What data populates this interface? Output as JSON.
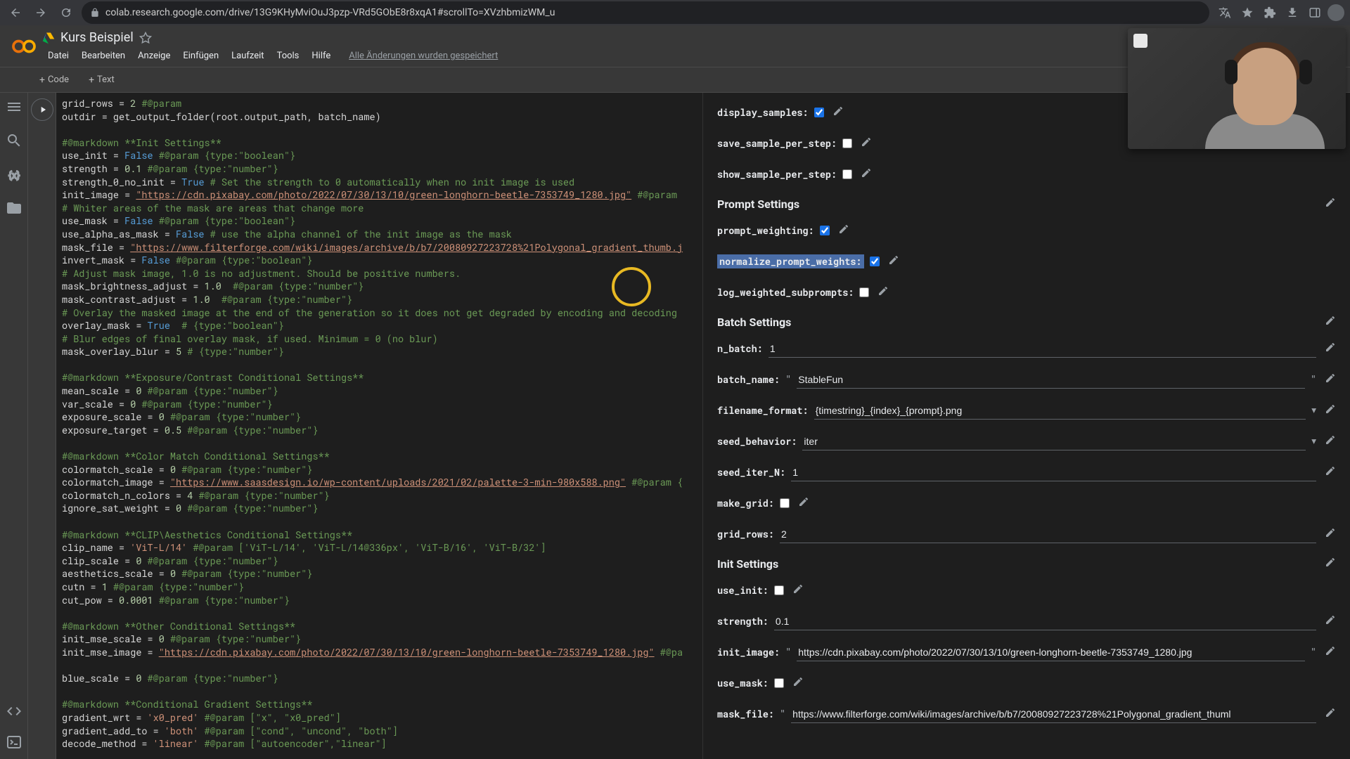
{
  "browser": {
    "url": "colab.research.google.com/drive/13G9KHyMviOuJ3pzp-VRd5GObE8r8xqA1#scrollTo=XVzhbmizWM_u"
  },
  "notebook": {
    "title": "Kurs Beispiel",
    "menus": [
      "Datei",
      "Bearbeiten",
      "Anzeige",
      "Einfügen",
      "Laufzeit",
      "Tools",
      "Hilfe"
    ],
    "saved_status": "Alle Änderungen wurden gespeichert"
  },
  "toolbar": {
    "code": "Code",
    "text": "Text"
  },
  "code": {
    "lines": [
      {
        "t": "grid_rows = ",
        "n": "2",
        "c": " #@param"
      },
      {
        "t": "outdir = get_output_folder(root.output_path, batch_name)"
      },
      {
        "blank": true
      },
      {
        "c": "#@markdown **Init Settings**"
      },
      {
        "t": "use_init = ",
        "b": "False",
        "c": " #@param {type:\"boolean\"}"
      },
      {
        "t": "strength = ",
        "n": "0.1",
        "c": " #@param {type:\"number\"}"
      },
      {
        "t": "strength_0_no_init = ",
        "b": "True",
        "c": " # Set the strength to 0 automatically when no init image is used"
      },
      {
        "t": "init_image = ",
        "s": "\"https://cdn.pixabay.com/photo/2022/07/30/13/10/green-longhorn-beetle-7353749_1280.jpg\"",
        "c": " #@param"
      },
      {
        "c": "# Whiter areas of the mask are areas that change more"
      },
      {
        "t": "use_mask = ",
        "b": "False",
        "c": " #@param {type:\"boolean\"}"
      },
      {
        "t": "use_alpha_as_mask = ",
        "b": "False",
        "c": " # use the alpha channel of the init image as the mask"
      },
      {
        "t": "mask_file = ",
        "s": "\"https://www.filterforge.com/wiki/images/archive/b/b7/20080927223728%21Polygonal_gradient_thumb.j"
      },
      {
        "t": "invert_mask = ",
        "b": "False",
        "c": " #@param {type:\"boolean\"}"
      },
      {
        "c": "# Adjust mask image, 1.0 is no adjustment. Should be positive numbers."
      },
      {
        "t": "mask_brightness_adjust = ",
        "n": "1.0",
        "c": "  #@param {type:\"number\"}"
      },
      {
        "t": "mask_contrast_adjust = ",
        "n": "1.0",
        "c": "  #@param {type:\"number\"}"
      },
      {
        "c": "# Overlay the masked image at the end of the generation so it does not get degraded by encoding and decoding"
      },
      {
        "t": "overlay_mask = ",
        "b": "True",
        "c": "  # {type:\"boolean\"}"
      },
      {
        "c": "# Blur edges of final overlay mask, if used. Minimum = 0 (no blur)"
      },
      {
        "t": "mask_overlay_blur = ",
        "n": "5",
        "c": " # {type:\"number\"}"
      },
      {
        "blank": true
      },
      {
        "c": "#@markdown **Exposure/Contrast Conditional Settings**"
      },
      {
        "t": "mean_scale = ",
        "n": "0",
        "c": " #@param {type:\"number\"}"
      },
      {
        "t": "var_scale = ",
        "n": "0",
        "c": " #@param {type:\"number\"}"
      },
      {
        "t": "exposure_scale = ",
        "n": "0",
        "c": " #@param {type:\"number\"}"
      },
      {
        "t": "exposure_target = ",
        "n": "0.5",
        "c": " #@param {type:\"number\"}"
      },
      {
        "blank": true
      },
      {
        "c": "#@markdown **Color Match Conditional Settings**"
      },
      {
        "t": "colormatch_scale = ",
        "n": "0",
        "c": " #@param {type:\"number\"}"
      },
      {
        "t": "colormatch_image = ",
        "s": "\"https://www.saasdesign.io/wp-content/uploads/2021/02/palette-3-min-980x588.png\"",
        "c": " #@param {"
      },
      {
        "t": "colormatch_n_colors = ",
        "n": "4",
        "c": " #@param {type:\"number\"}"
      },
      {
        "t": "ignore_sat_weight = ",
        "n": "0",
        "c": " #@param {type:\"number\"}"
      },
      {
        "blank": true
      },
      {
        "c": "#@markdown **CLIP\\Aesthetics Conditional Settings**"
      },
      {
        "t": "clip_name = ",
        "sn": "'ViT-L/14'",
        "c": " #@param ['ViT-L/14', 'ViT-L/14@336px', 'ViT-B/16', 'ViT-B/32']"
      },
      {
        "t": "clip_scale = ",
        "n": "0",
        "c": " #@param {type:\"number\"}"
      },
      {
        "t": "aesthetics_scale = ",
        "n": "0",
        "c": " #@param {type:\"number\"}"
      },
      {
        "t": "cutn = ",
        "n": "1",
        "c": " #@param {type:\"number\"}"
      },
      {
        "t": "cut_pow = ",
        "n": "0.0001",
        "c": " #@param {type:\"number\"}"
      },
      {
        "blank": true
      },
      {
        "c": "#@markdown **Other Conditional Settings**"
      },
      {
        "t": "init_mse_scale = ",
        "n": "0",
        "c": " #@param {type:\"number\"}"
      },
      {
        "t": "init_mse_image = ",
        "s": "\"https://cdn.pixabay.com/photo/2022/07/30/13/10/green-longhorn-beetle-7353749_1280.jpg\"",
        "c": " #@pa"
      },
      {
        "blank": true
      },
      {
        "t": "blue_scale = ",
        "n": "0",
        "c": " #@param {type:\"number\"}"
      },
      {
        "blank": true
      },
      {
        "c": "#@markdown **Conditional Gradient Settings**"
      },
      {
        "t": "gradient_wrt = ",
        "sn": "'x0_pred'",
        "c": " #@param [\"x\", \"x0_pred\"]"
      },
      {
        "t": "gradient_add_to = ",
        "sn": "'both'",
        "c": " #@param [\"cond\", \"uncond\", \"both\"]"
      },
      {
        "t": "decode_method = ",
        "sn": "'linear'",
        "c": " #@param [\"autoencoder\",\"linear\"]"
      }
    ]
  },
  "form": {
    "display_samples": {
      "label": "display_samples:",
      "checked": true
    },
    "save_sample_per_step": {
      "label": "save_sample_per_step:",
      "checked": false
    },
    "show_sample_per_step": {
      "label": "show_sample_per_step:",
      "checked": false
    },
    "prompt_settings_header": "Prompt Settings",
    "prompt_weighting": {
      "label": "prompt_weighting:",
      "checked": true
    },
    "normalize_prompt_weights": {
      "label": "normalize_prompt_weights:",
      "checked": true
    },
    "log_weighted_subprompts": {
      "label": "log_weighted_subprompts:",
      "checked": false
    },
    "batch_settings_header": "Batch Settings",
    "n_batch": {
      "label": "n_batch:",
      "value": "1"
    },
    "batch_name": {
      "label": "batch_name:",
      "value": "StableFun"
    },
    "filename_format": {
      "label": "filename_format:",
      "value": "{timestring}_{index}_{prompt}.png"
    },
    "seed_behavior": {
      "label": "seed_behavior:",
      "value": "iter"
    },
    "seed_iter_N": {
      "label": "seed_iter_N:",
      "value": "1"
    },
    "make_grid": {
      "label": "make_grid:",
      "checked": false
    },
    "grid_rows": {
      "label": "grid_rows:",
      "value": "2"
    },
    "init_settings_header": "Init Settings",
    "use_init": {
      "label": "use_init:",
      "checked": false
    },
    "strength": {
      "label": "strength:",
      "value": "0.1"
    },
    "init_image": {
      "label": "init_image:",
      "value": "https://cdn.pixabay.com/photo/2022/07/30/13/10/green-longhorn-beetle-7353749_1280.jpg"
    },
    "use_mask": {
      "label": "use_mask:",
      "checked": false
    },
    "mask_file": {
      "label": "mask_file:",
      "value": "https://www.filterforge.com/wiki/images/archive/b/b7/20080927223728%21Polygonal_gradient_thuml"
    }
  }
}
